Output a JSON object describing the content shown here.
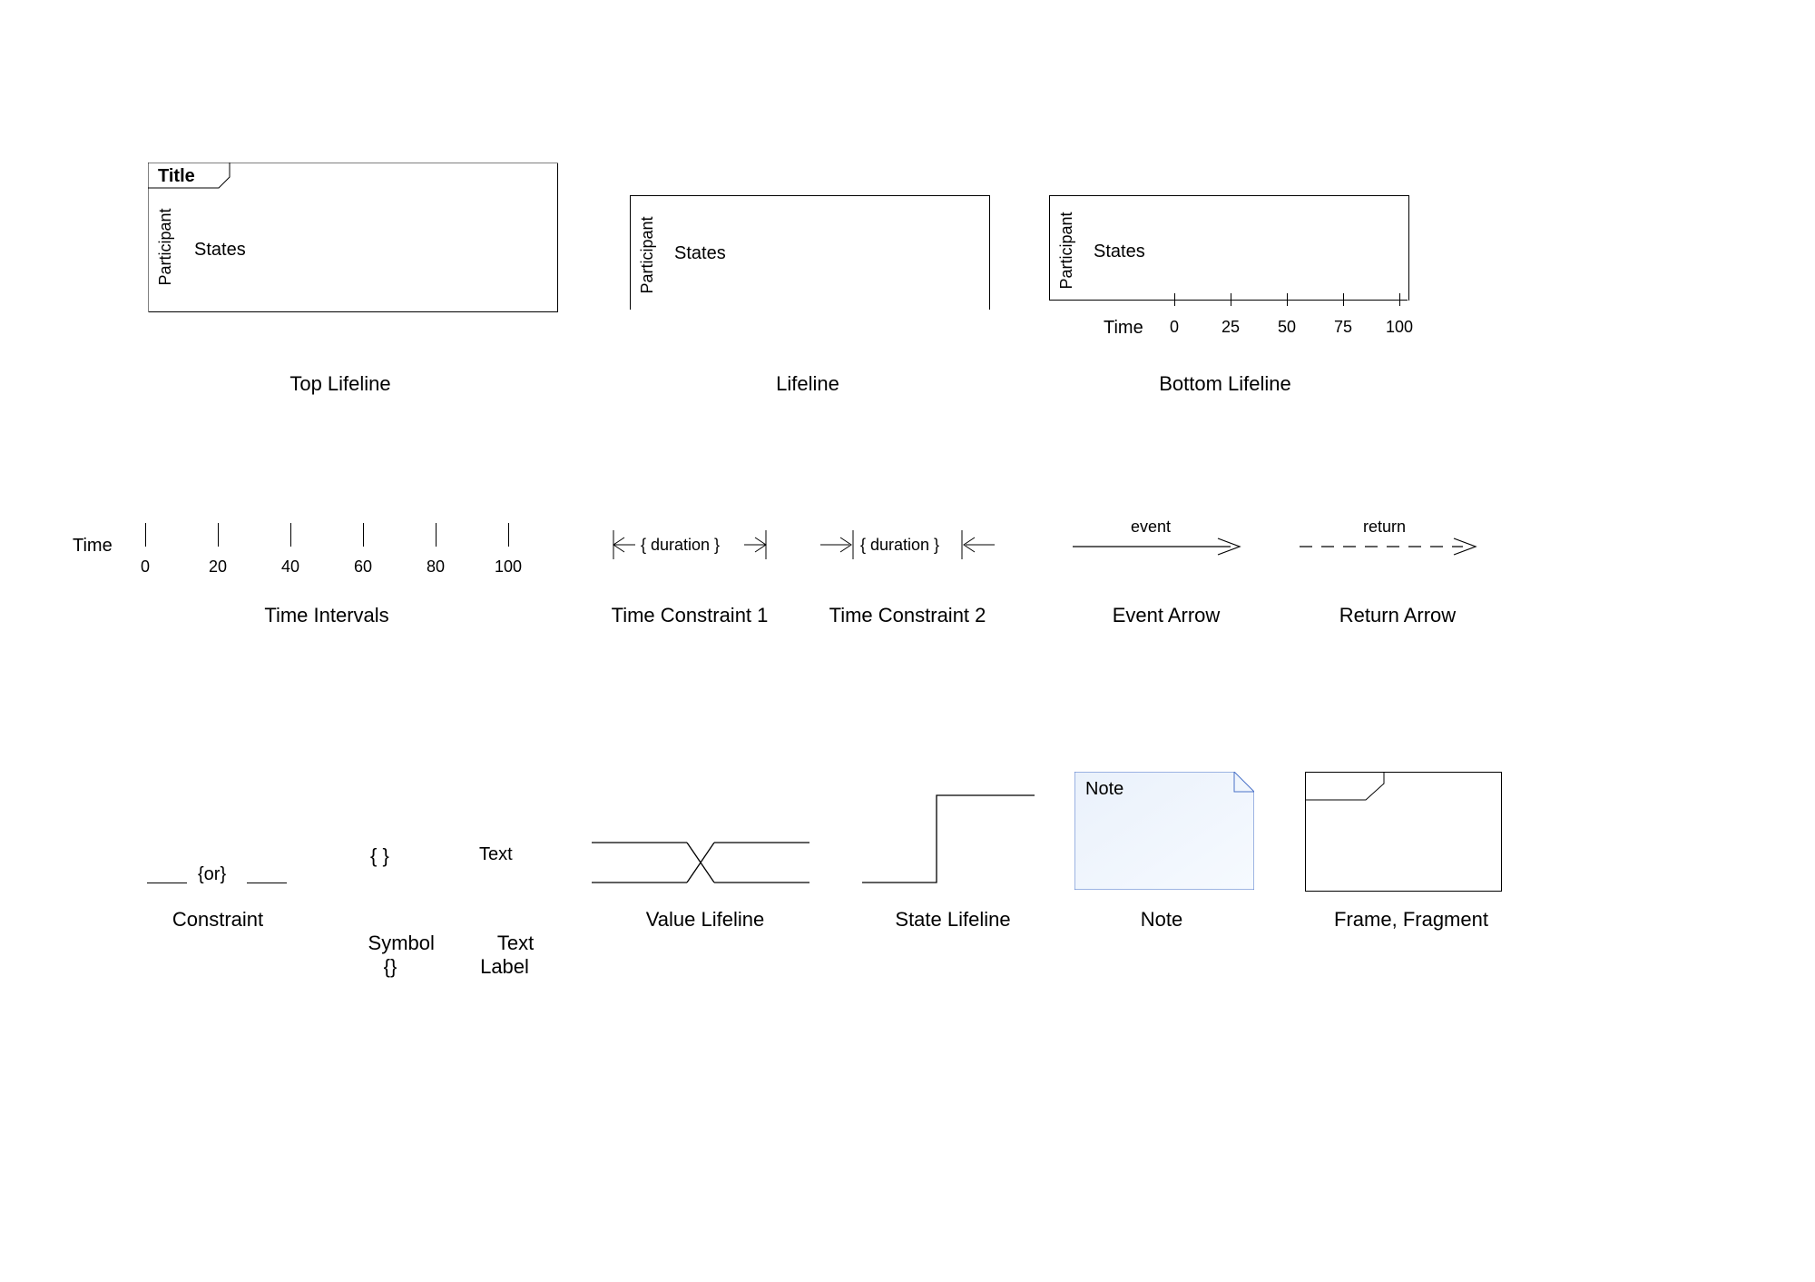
{
  "row1": {
    "topLifeline": {
      "title": "Title",
      "participant": "Participant",
      "states": "States",
      "caption": "Top Lifeline"
    },
    "lifeline": {
      "participant": "Participant",
      "states": "States",
      "caption": "Lifeline"
    },
    "bottomLifeline": {
      "participant": "Participant",
      "states": "States",
      "timeLabel": "Time",
      "ticks": [
        "0",
        "25",
        "50",
        "75",
        "100"
      ],
      "caption": "Bottom Lifeline"
    }
  },
  "row2": {
    "timeIntervals": {
      "label": "Time",
      "ticks": [
        "0",
        "20",
        "40",
        "60",
        "80",
        "100"
      ],
      "caption": "Time Intervals"
    },
    "tc1": {
      "text": "{ duration }",
      "caption": "Time Constraint 1"
    },
    "tc2": {
      "text": "{ duration }",
      "caption": "Time Constraint 2"
    },
    "eventArrow": {
      "text": "event",
      "caption": "Event Arrow"
    },
    "returnArrow": {
      "text": "return",
      "caption": "Return Arrow"
    }
  },
  "row3": {
    "constraint": {
      "text": "{or}",
      "caption": "Constraint"
    },
    "symbol": {
      "text": "{ }",
      "caption": "Symbol",
      "caption2": "{}"
    },
    "textLabel": {
      "text": "Text",
      "caption": "Text",
      "caption2": "Label"
    },
    "valueLifeline": {
      "caption": "Value Lifeline"
    },
    "stateLifeline": {
      "caption": "State Lifeline"
    },
    "note": {
      "text": "Note",
      "caption": "Note"
    },
    "frame": {
      "caption": "Frame, Fragment"
    }
  }
}
